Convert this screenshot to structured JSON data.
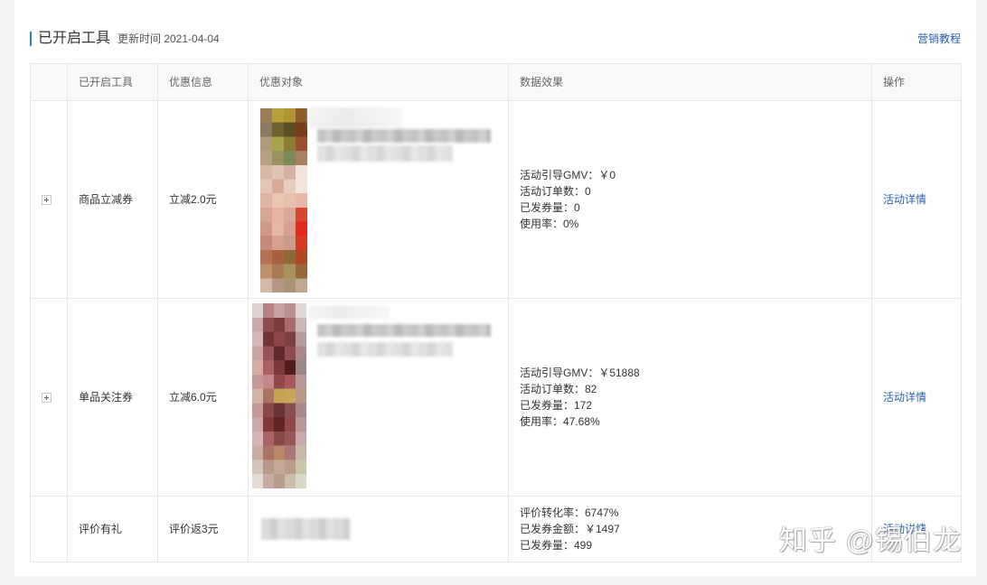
{
  "header": {
    "title": "已开启工具",
    "update_time": "更新时间 2021-04-04",
    "tutorial_link": "营销教程"
  },
  "table": {
    "columns": {
      "tool": "已开启工具",
      "discount": "优惠信息",
      "target": "优惠对象",
      "effect": "数据效果",
      "action": "操作"
    },
    "rows": [
      {
        "tool": "商品立减券",
        "discount": "立减2.0元",
        "effect": [
          "活动引导GMV：￥0",
          "活动订单数：0",
          "已发券量：0",
          "使用率：0%"
        ],
        "action": "活动详情"
      },
      {
        "tool": "单品关注券",
        "discount": "立减6.0元",
        "effect": [
          "活动引导GMV：￥51888",
          "活动订单数：82",
          "已发券量：172",
          "使用率：47.68%"
        ],
        "action": "活动详情"
      },
      {
        "tool": "评价有礼",
        "discount": "评价返3元",
        "effect": [
          "评价转化率：6747%",
          "已发券金额：￥1497",
          "已发券量：499"
        ],
        "action": "活动详情"
      }
    ]
  },
  "icons": {
    "expand": "plus-icon"
  },
  "watermark": "知乎 @锡伯龙",
  "colors": {
    "accent": "#2e7ae0",
    "link": "#2a5fb3"
  }
}
